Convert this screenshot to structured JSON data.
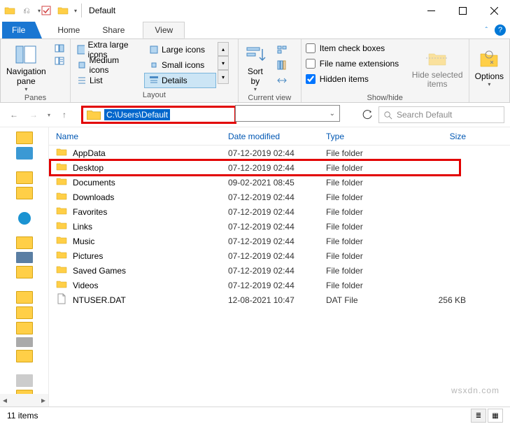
{
  "window": {
    "title": "Default"
  },
  "tabs": {
    "file": "File",
    "home": "Home",
    "share": "Share",
    "view": "View"
  },
  "ribbon": {
    "panes": {
      "nav": "Navigation\npane",
      "label": "Panes"
    },
    "layout": {
      "label": "Layout",
      "xl": "Extra large icons",
      "l": "Large icons",
      "m": "Medium icons",
      "s": "Small icons",
      "list": "List",
      "details": "Details"
    },
    "cv": {
      "sort": "Sort\nby",
      "label": "Current view"
    },
    "sh": {
      "check": "Item check boxes",
      "ext": "File name extensions",
      "hidden": "Hidden items",
      "hide": "Hide selected\nitems",
      "label": "Show/hide"
    },
    "options": "Options"
  },
  "nav": {
    "path": "C:\\Users\\Default",
    "search_ph": "Search Default"
  },
  "columns": {
    "name": "Name",
    "date": "Date modified",
    "type": "Type",
    "size": "Size"
  },
  "rows": [
    {
      "name": "AppData",
      "date": "07-12-2019 02:44",
      "type": "File folder",
      "size": "",
      "icon": "folder",
      "highlight": false
    },
    {
      "name": "Desktop",
      "date": "07-12-2019 02:44",
      "type": "File folder",
      "size": "",
      "icon": "folder",
      "highlight": true
    },
    {
      "name": "Documents",
      "date": "09-02-2021 08:45",
      "type": "File folder",
      "size": "",
      "icon": "folder",
      "highlight": false
    },
    {
      "name": "Downloads",
      "date": "07-12-2019 02:44",
      "type": "File folder",
      "size": "",
      "icon": "folder",
      "highlight": false
    },
    {
      "name": "Favorites",
      "date": "07-12-2019 02:44",
      "type": "File folder",
      "size": "",
      "icon": "folder",
      "highlight": false
    },
    {
      "name": "Links",
      "date": "07-12-2019 02:44",
      "type": "File folder",
      "size": "",
      "icon": "folder",
      "highlight": false
    },
    {
      "name": "Music",
      "date": "07-12-2019 02:44",
      "type": "File folder",
      "size": "",
      "icon": "folder",
      "highlight": false
    },
    {
      "name": "Pictures",
      "date": "07-12-2019 02:44",
      "type": "File folder",
      "size": "",
      "icon": "folder",
      "highlight": false
    },
    {
      "name": "Saved Games",
      "date": "07-12-2019 02:44",
      "type": "File folder",
      "size": "",
      "icon": "folder",
      "highlight": false
    },
    {
      "name": "Videos",
      "date": "07-12-2019 02:44",
      "type": "File folder",
      "size": "",
      "icon": "folder",
      "highlight": false
    },
    {
      "name": "NTUSER.DAT",
      "date": "12-08-2021 10:47",
      "type": "DAT File",
      "size": "256 KB",
      "icon": "file",
      "highlight": false
    }
  ],
  "status": {
    "count": "11 items"
  },
  "watermark": "wsxdn.com"
}
